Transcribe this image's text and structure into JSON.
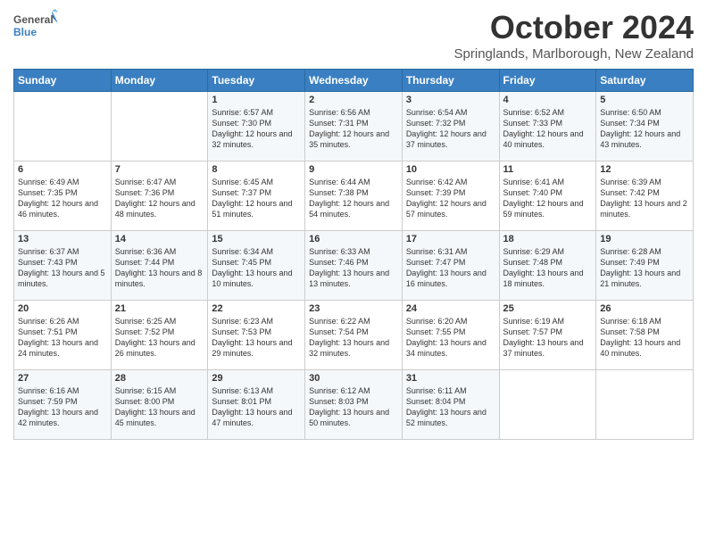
{
  "logo": {
    "line1": "General",
    "line2": "Blue"
  },
  "title": "October 2024",
  "location": "Springlands, Marlborough, New Zealand",
  "days_of_week": [
    "Sunday",
    "Monday",
    "Tuesday",
    "Wednesday",
    "Thursday",
    "Friday",
    "Saturday"
  ],
  "weeks": [
    [
      {
        "day": "",
        "content": ""
      },
      {
        "day": "",
        "content": ""
      },
      {
        "day": "1",
        "content": "Sunrise: 6:57 AM\nSunset: 7:30 PM\nDaylight: 12 hours and 32 minutes."
      },
      {
        "day": "2",
        "content": "Sunrise: 6:56 AM\nSunset: 7:31 PM\nDaylight: 12 hours and 35 minutes."
      },
      {
        "day": "3",
        "content": "Sunrise: 6:54 AM\nSunset: 7:32 PM\nDaylight: 12 hours and 37 minutes."
      },
      {
        "day": "4",
        "content": "Sunrise: 6:52 AM\nSunset: 7:33 PM\nDaylight: 12 hours and 40 minutes."
      },
      {
        "day": "5",
        "content": "Sunrise: 6:50 AM\nSunset: 7:34 PM\nDaylight: 12 hours and 43 minutes."
      }
    ],
    [
      {
        "day": "6",
        "content": "Sunrise: 6:49 AM\nSunset: 7:35 PM\nDaylight: 12 hours and 46 minutes."
      },
      {
        "day": "7",
        "content": "Sunrise: 6:47 AM\nSunset: 7:36 PM\nDaylight: 12 hours and 48 minutes."
      },
      {
        "day": "8",
        "content": "Sunrise: 6:45 AM\nSunset: 7:37 PM\nDaylight: 12 hours and 51 minutes."
      },
      {
        "day": "9",
        "content": "Sunrise: 6:44 AM\nSunset: 7:38 PM\nDaylight: 12 hours and 54 minutes."
      },
      {
        "day": "10",
        "content": "Sunrise: 6:42 AM\nSunset: 7:39 PM\nDaylight: 12 hours and 57 minutes."
      },
      {
        "day": "11",
        "content": "Sunrise: 6:41 AM\nSunset: 7:40 PM\nDaylight: 12 hours and 59 minutes."
      },
      {
        "day": "12",
        "content": "Sunrise: 6:39 AM\nSunset: 7:42 PM\nDaylight: 13 hours and 2 minutes."
      }
    ],
    [
      {
        "day": "13",
        "content": "Sunrise: 6:37 AM\nSunset: 7:43 PM\nDaylight: 13 hours and 5 minutes."
      },
      {
        "day": "14",
        "content": "Sunrise: 6:36 AM\nSunset: 7:44 PM\nDaylight: 13 hours and 8 minutes."
      },
      {
        "day": "15",
        "content": "Sunrise: 6:34 AM\nSunset: 7:45 PM\nDaylight: 13 hours and 10 minutes."
      },
      {
        "day": "16",
        "content": "Sunrise: 6:33 AM\nSunset: 7:46 PM\nDaylight: 13 hours and 13 minutes."
      },
      {
        "day": "17",
        "content": "Sunrise: 6:31 AM\nSunset: 7:47 PM\nDaylight: 13 hours and 16 minutes."
      },
      {
        "day": "18",
        "content": "Sunrise: 6:29 AM\nSunset: 7:48 PM\nDaylight: 13 hours and 18 minutes."
      },
      {
        "day": "19",
        "content": "Sunrise: 6:28 AM\nSunset: 7:49 PM\nDaylight: 13 hours and 21 minutes."
      }
    ],
    [
      {
        "day": "20",
        "content": "Sunrise: 6:26 AM\nSunset: 7:51 PM\nDaylight: 13 hours and 24 minutes."
      },
      {
        "day": "21",
        "content": "Sunrise: 6:25 AM\nSunset: 7:52 PM\nDaylight: 13 hours and 26 minutes."
      },
      {
        "day": "22",
        "content": "Sunrise: 6:23 AM\nSunset: 7:53 PM\nDaylight: 13 hours and 29 minutes."
      },
      {
        "day": "23",
        "content": "Sunrise: 6:22 AM\nSunset: 7:54 PM\nDaylight: 13 hours and 32 minutes."
      },
      {
        "day": "24",
        "content": "Sunrise: 6:20 AM\nSunset: 7:55 PM\nDaylight: 13 hours and 34 minutes."
      },
      {
        "day": "25",
        "content": "Sunrise: 6:19 AM\nSunset: 7:57 PM\nDaylight: 13 hours and 37 minutes."
      },
      {
        "day": "26",
        "content": "Sunrise: 6:18 AM\nSunset: 7:58 PM\nDaylight: 13 hours and 40 minutes."
      }
    ],
    [
      {
        "day": "27",
        "content": "Sunrise: 6:16 AM\nSunset: 7:59 PM\nDaylight: 13 hours and 42 minutes."
      },
      {
        "day": "28",
        "content": "Sunrise: 6:15 AM\nSunset: 8:00 PM\nDaylight: 13 hours and 45 minutes."
      },
      {
        "day": "29",
        "content": "Sunrise: 6:13 AM\nSunset: 8:01 PM\nDaylight: 13 hours and 47 minutes."
      },
      {
        "day": "30",
        "content": "Sunrise: 6:12 AM\nSunset: 8:03 PM\nDaylight: 13 hours and 50 minutes."
      },
      {
        "day": "31",
        "content": "Sunrise: 6:11 AM\nSunset: 8:04 PM\nDaylight: 13 hours and 52 minutes."
      },
      {
        "day": "",
        "content": ""
      },
      {
        "day": "",
        "content": ""
      }
    ]
  ]
}
